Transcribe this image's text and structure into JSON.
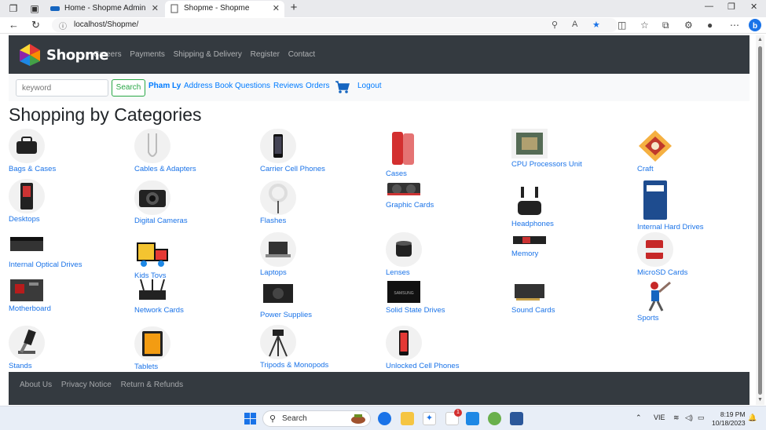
{
  "browser": {
    "tabs": [
      {
        "title": "Home - Shopme Admin",
        "active": false
      },
      {
        "title": "Shopme - Shopme",
        "active": true
      }
    ],
    "url": "localhost/Shopme/"
  },
  "header": {
    "logo_text": "Shopme",
    "nav": [
      "Careers",
      "Payments",
      "Shipping & Delivery",
      "Register",
      "Contact"
    ]
  },
  "subnav": {
    "search_placeholder": "keyword",
    "search_button": "Search",
    "user_name": "Pham Ly",
    "links": [
      "Address Book",
      "Questions",
      "Reviews",
      "Orders"
    ],
    "logout": "Logout"
  },
  "page": {
    "title": "Shopping by Categories",
    "categories": [
      "Bags & Cases",
      "Cables & Adapters",
      "Carrier Cell Phones",
      "Cases",
      "CPU Processors Unit",
      "Craft",
      "Desktops",
      "Digital Cameras",
      "Flashes",
      "Graphic Cards",
      "Headphones",
      "Internal Hard Drives",
      "Internal Optical Drives",
      "Kids Toys",
      "Laptops",
      "Lenses",
      "Memory",
      "MicroSD Cards",
      "Motherboard",
      "Network Cards",
      "Power Supplies",
      "Solid State Drives",
      "Sound Cards",
      "Sports",
      "Stands",
      "Tablets",
      "Tripods & Monopods",
      "Unlocked Cell Phones"
    ]
  },
  "footer": {
    "links": [
      "About Us",
      "Privacy Notice",
      "Return & Refunds"
    ]
  },
  "taskbar": {
    "search": "Search",
    "lang": "VIE",
    "time": "8:19 PM",
    "date": "10/18/2023",
    "badge": "1"
  },
  "colors": {
    "header_bg": "#343a40",
    "link": "#007bff",
    "search_button": "#28a745"
  }
}
